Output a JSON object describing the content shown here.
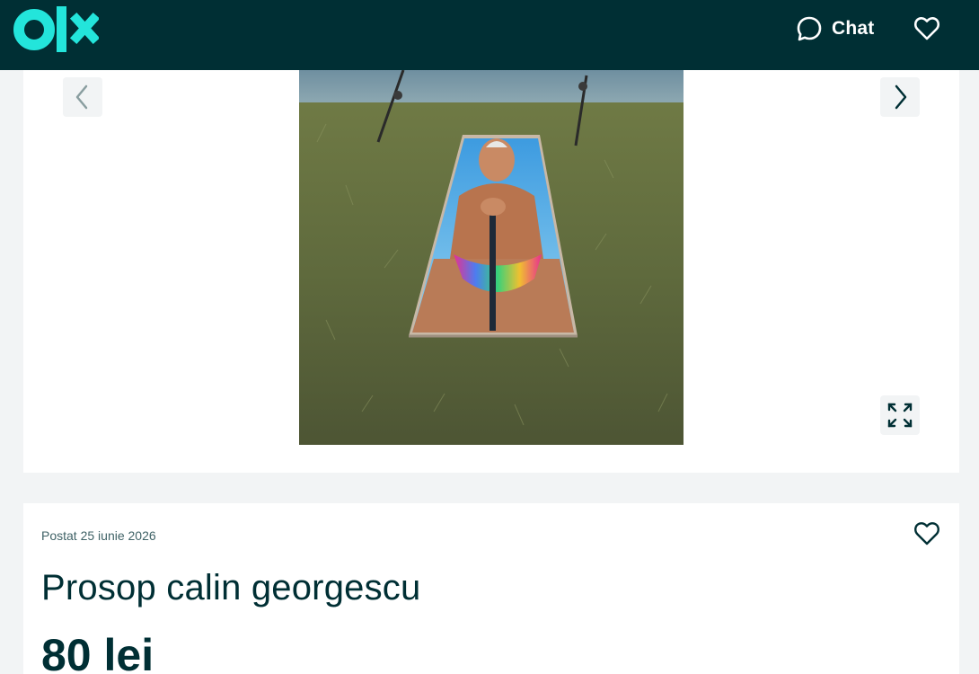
{
  "header": {
    "logo_text": "olx",
    "chat_label": "Chat",
    "icons": {
      "chat": "chat-bubble-icon",
      "favorite": "heart-outline-icon"
    }
  },
  "gallery": {
    "image_alt": "Photo of a beach towel printed with a smiling man in rainbow swim briefs, laid on grass beside a lake with two fishing rods",
    "icons": {
      "prev": "chevron-left-icon",
      "next": "chevron-right-icon",
      "fullscreen": "expand-icon"
    }
  },
  "ad": {
    "posted": "Postat 25 iunie 2026",
    "title": "Prosop calin georgescu",
    "price": "80 lei"
  },
  "colors": {
    "brand_dark": "#002f34",
    "brand_accent": "#23e5db",
    "page_bg": "#f2f4f5",
    "card_bg": "#ffffff"
  }
}
